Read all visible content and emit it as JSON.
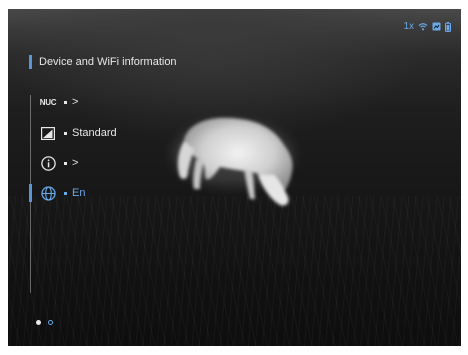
{
  "status_bar": {
    "zoom": "1x",
    "icons": [
      "wifi-icon",
      "recording-icon",
      "battery-icon"
    ],
    "color": "#6aa8e8"
  },
  "menu": {
    "title": "Device and WiFi information",
    "accent_color": "#5b95d8",
    "items": [
      {
        "icon": "nuc-icon",
        "icon_text": "NUC",
        "value": ">"
      },
      {
        "icon": "picture-mode-icon",
        "value": "Standard"
      },
      {
        "icon": "info-icon",
        "value": ">"
      },
      {
        "icon": "globe-icon",
        "value": "En",
        "active": true
      }
    ]
  },
  "pager": {
    "pages": 2,
    "current": 1
  }
}
